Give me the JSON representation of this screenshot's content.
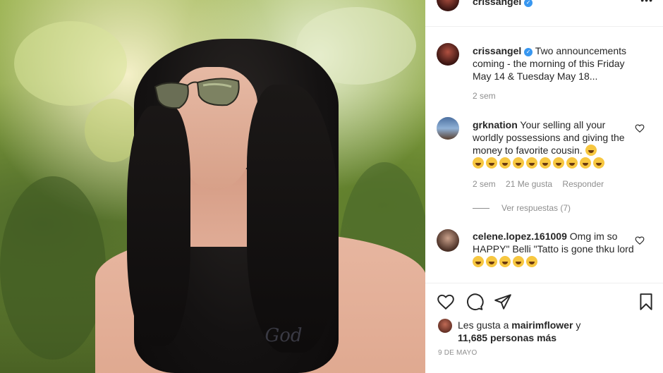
{
  "post": {
    "username": "crissangel",
    "verified_badge": "✓",
    "more_icon": "more-options-icon",
    "caption_username": "crissangel",
    "caption_text": "Two announcements coming - the morning of this Friday May 14 & Tuesday May 18...",
    "caption_time": "2 sem",
    "tattoo_text": "God"
  },
  "comments": [
    {
      "username": "grknation",
      "text": "Your selling all your worldly possessions and giving the money to favorite cousin.",
      "emoji_count_inline": 1,
      "emoji_row_count": 10,
      "time": "2 sem",
      "likes": "21 Me gusta",
      "reply_label": "Responder",
      "view_replies": "Ver respuestas (7)"
    },
    {
      "username": "celene.lopez.161009",
      "text": "Omg im so HAPPY\" Belli \"Tatto is gone thku lord",
      "emoji_count_inline": 5
    }
  ],
  "actions": {
    "like_icon": "heart-icon",
    "comment_icon": "comment-icon",
    "share_icon": "send-icon",
    "save_icon": "bookmark-icon"
  },
  "likes_line": {
    "prefix": "Les gusta a",
    "user": "mairimflower",
    "conjunction": "y",
    "others": "11,685 personas más"
  },
  "date": "9 DE MAYO",
  "colors": {
    "verified": "#3897f0",
    "text": "#262626",
    "muted": "#8e8e8e",
    "divider": "#efefef"
  }
}
